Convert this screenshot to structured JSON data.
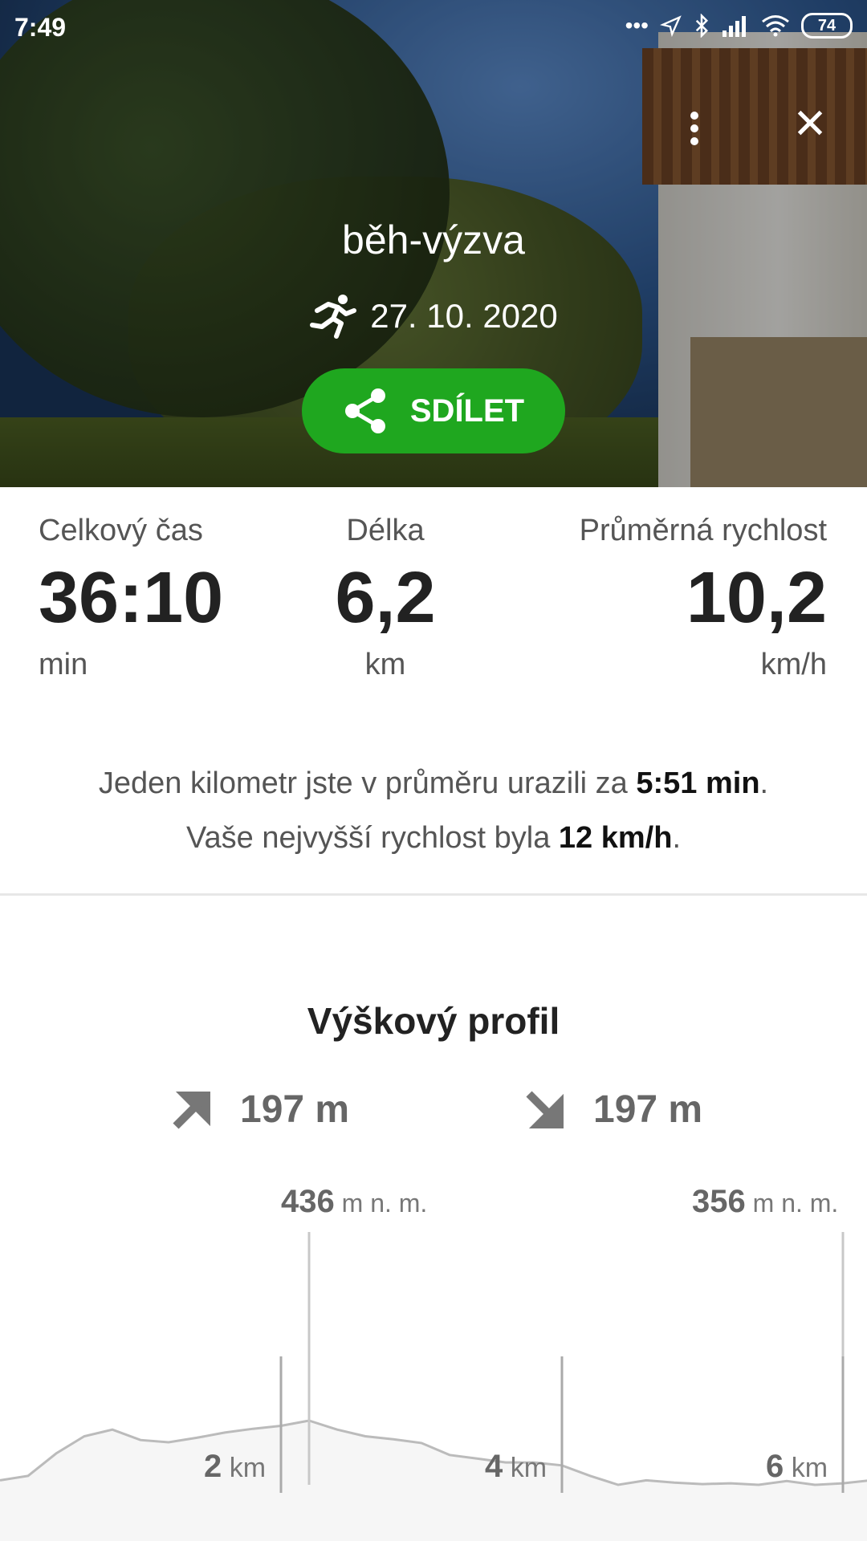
{
  "status_bar": {
    "time": "7:49",
    "battery": "74"
  },
  "header": {
    "title": "běh-výzva",
    "date": "27. 10. 2020",
    "share_label": "SDÍLET"
  },
  "stats": [
    {
      "label": "Celkový čas",
      "value": "36:10",
      "unit": "min"
    },
    {
      "label": "Délka",
      "value": "6,2",
      "unit": "km"
    },
    {
      "label": "Průměrná rychlost",
      "value": "10,2",
      "unit": "km/h"
    }
  ],
  "summary": {
    "line1_prefix": "Jeden kilometr jste v průměru urazili za ",
    "line1_value": "5:51 min",
    "line1_suffix": ".",
    "line2_prefix": "Vaše nejvyšší rychlost byla ",
    "line2_value": "12 km/h",
    "line2_suffix": "."
  },
  "profile": {
    "title": "Výškový profil",
    "ascent": "197 m",
    "descent": "197 m",
    "max_value": "436",
    "max_unit": "m n. m.",
    "end_value": "356",
    "end_unit": "m n. m.",
    "distance_marks": [
      {
        "value": "2",
        "unit": "km"
      },
      {
        "value": "4",
        "unit": "km"
      },
      {
        "value": "6",
        "unit": "km"
      }
    ]
  },
  "chart_data": {
    "type": "area",
    "x_unit": "km",
    "y_unit": "m n. m.",
    "x": [
      0,
      0.2,
      0.4,
      0.6,
      0.8,
      1.0,
      1.2,
      1.4,
      1.6,
      1.8,
      2.0,
      2.2,
      2.4,
      2.6,
      2.8,
      3.0,
      3.2,
      3.4,
      3.6,
      3.8,
      4.0,
      4.2,
      4.4,
      4.6,
      4.8,
      5.0,
      5.2,
      5.4,
      5.6,
      5.8,
      6.0,
      6.2
    ],
    "y": [
      356,
      362,
      392,
      415,
      424,
      410,
      407,
      413,
      420,
      425,
      429,
      436,
      424,
      415,
      411,
      406,
      390,
      385,
      380,
      380,
      376,
      362,
      350,
      356,
      353,
      351,
      352,
      350,
      355,
      350,
      352,
      356
    ],
    "markers": [
      {
        "x": 2.2,
        "label": "436"
      },
      {
        "x": 6.0,
        "label": "356"
      }
    ],
    "xticks": [
      2,
      4,
      6
    ]
  }
}
